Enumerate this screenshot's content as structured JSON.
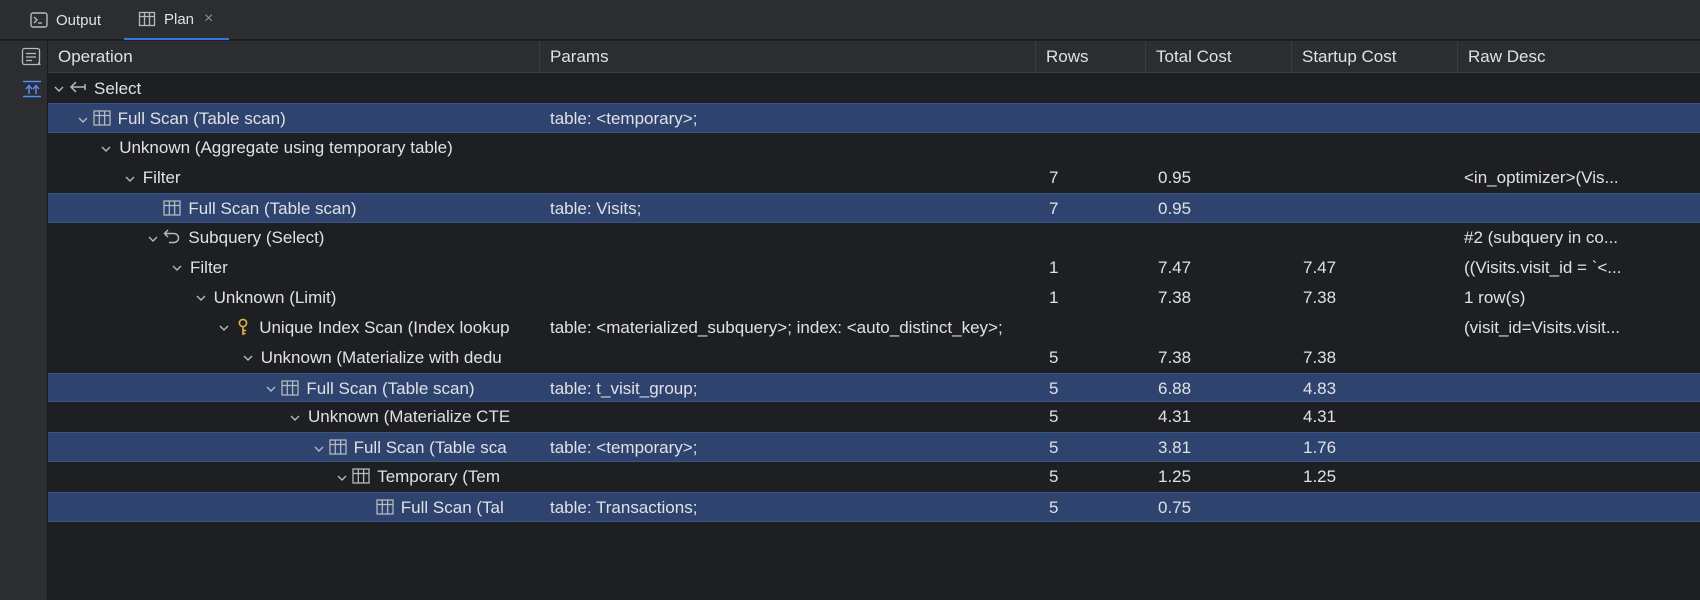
{
  "tabs": [
    {
      "label": "Output",
      "icon": "console-icon"
    },
    {
      "label": "Plan",
      "icon": "table-icon",
      "close": "×"
    }
  ],
  "columns": [
    "Operation",
    "Params",
    "Rows",
    "Total Cost",
    "Startup Cost",
    "Raw Desc"
  ],
  "rows": [
    {
      "op": "Select",
      "params": "",
      "rows": "",
      "total": "",
      "startup": "",
      "raw": "",
      "depth": 0,
      "expand": true,
      "icon": "back-arrow-icon",
      "selected": false
    },
    {
      "op": "Full Scan (Table scan)",
      "params": "table: <temporary>;",
      "rows": "",
      "total": "",
      "startup": "",
      "raw": "",
      "depth": 1,
      "expand": true,
      "icon": "table-icon",
      "selected": true
    },
    {
      "op": "Unknown (Aggregate using temporary table)",
      "params": "",
      "rows": "",
      "total": "",
      "startup": "",
      "raw": "",
      "depth": 2,
      "expand": true,
      "icon": "",
      "selected": false
    },
    {
      "op": "Filter",
      "params": "",
      "rows": "7",
      "total": "0.95",
      "startup": "",
      "raw": "<in_optimizer>(Vis...",
      "depth": 3,
      "expand": true,
      "icon": "",
      "selected": false
    },
    {
      "op": "Full Scan (Table scan)",
      "params": "table: Visits;",
      "rows": "7",
      "total": "0.95",
      "startup": "",
      "raw": "",
      "depth": 4,
      "expand": false,
      "icon": "table-icon",
      "selected": true
    },
    {
      "op": "Subquery (Select)",
      "params": "",
      "rows": "",
      "total": "",
      "startup": "",
      "raw": "#2 (subquery in co...",
      "depth": 4,
      "expand": true,
      "icon": "undo-arrow-icon",
      "selected": false
    },
    {
      "op": "Filter",
      "params": "",
      "rows": "1",
      "total": "7.47",
      "startup": "7.47",
      "raw": "((Visits.visit_id = `<...",
      "depth": 5,
      "expand": true,
      "icon": "",
      "selected": false
    },
    {
      "op": "Unknown (Limit)",
      "params": "",
      "rows": "1",
      "total": "7.38",
      "startup": "7.38",
      "raw": "1 row(s)",
      "depth": 6,
      "expand": true,
      "icon": "",
      "selected": false
    },
    {
      "op": "Unique Index Scan (Index lookup",
      "params": "table: <materialized_subquery>; index: <auto_distinct_key>;",
      "rows": "",
      "total": "",
      "startup": "",
      "raw": "(visit_id=Visits.visit...",
      "depth": 7,
      "expand": true,
      "icon": "key-icon",
      "selected": false
    },
    {
      "op": "Unknown (Materialize with dedu",
      "params": "",
      "rows": "5",
      "total": "7.38",
      "startup": "7.38",
      "raw": "",
      "depth": 8,
      "expand": true,
      "icon": "",
      "selected": false
    },
    {
      "op": "Full Scan (Table scan)",
      "params": "table: t_visit_group;",
      "rows": "5",
      "total": "6.88",
      "startup": "4.83",
      "raw": "",
      "depth": 9,
      "expand": true,
      "icon": "table-icon",
      "selected": true
    },
    {
      "op": "Unknown (Materialize CTE",
      "params": "",
      "rows": "5",
      "total": "4.31",
      "startup": "4.31",
      "raw": "",
      "depth": 10,
      "expand": true,
      "icon": "",
      "selected": false
    },
    {
      "op": "Full Scan (Table sca",
      "params": "table: <temporary>;",
      "rows": "5",
      "total": "3.81",
      "startup": "1.76",
      "raw": "",
      "depth": 11,
      "expand": true,
      "icon": "table-icon",
      "selected": true
    },
    {
      "op": "Temporary (Tem",
      "params": "",
      "rows": "5",
      "total": "1.25",
      "startup": "1.25",
      "raw": "",
      "depth": 12,
      "expand": true,
      "icon": "table-icon",
      "selected": false
    },
    {
      "op": "Full Scan (Tal",
      "params": "table: Transactions;",
      "rows": "5",
      "total": "0.75",
      "startup": "",
      "raw": "",
      "depth": 13,
      "expand": false,
      "icon": "table-icon",
      "selected": true
    }
  ],
  "colors": {
    "background": "#1e1f22",
    "panel": "#2b2d30",
    "selected_row": "#2e436e",
    "accent": "#3574f0",
    "key_icon": "#e2b14a"
  }
}
